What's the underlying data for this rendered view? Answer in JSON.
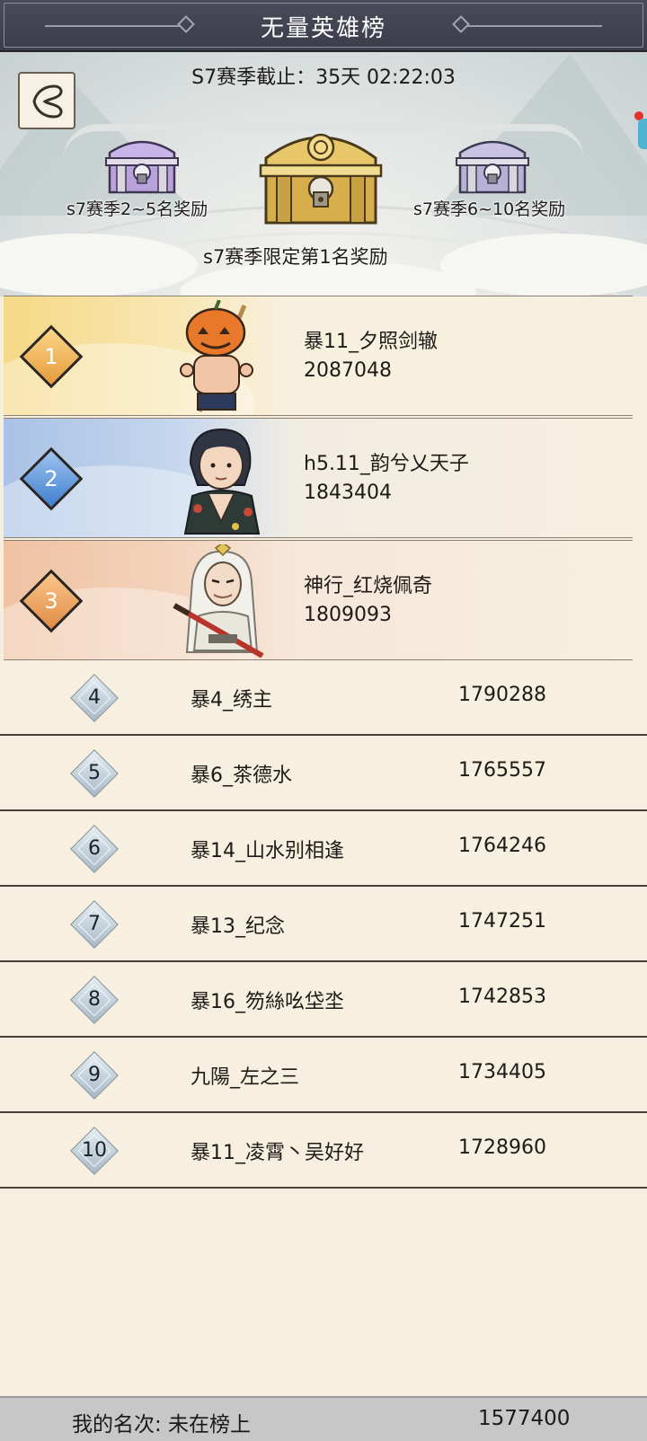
{
  "header": {
    "title": "无量英雄榜",
    "season_timer": "S7赛季截止：35天 02:22:03"
  },
  "rewards": {
    "left_label": "s7赛季2~5名奖励",
    "center_label": "s7赛季限定第1名奖励",
    "right_label": "s7赛季6~10名奖励"
  },
  "top3": [
    {
      "rank": "1",
      "name": "暴11_夕照剑辙",
      "score": "2087048"
    },
    {
      "rank": "2",
      "name": "h5.11_韵兮乂天子",
      "score": "1843404"
    },
    {
      "rank": "3",
      "name": "神行_红烧佩奇",
      "score": "1809093"
    }
  ],
  "list": [
    {
      "rank": "4",
      "name": "暴4_绣主",
      "score": "1790288"
    },
    {
      "rank": "5",
      "name": "暴6_茶德水",
      "score": "1765557"
    },
    {
      "rank": "6",
      "name": "暴14_山水别相逢",
      "score": "1764246"
    },
    {
      "rank": "7",
      "name": "暴13_纪念",
      "score": "1747251"
    },
    {
      "rank": "8",
      "name": "暴16_笏絲吆垈坔",
      "score": "1742853"
    },
    {
      "rank": "9",
      "name": "九陽_左之三",
      "score": "1734405"
    },
    {
      "rank": "10",
      "name": "暴11_凌霄丶吴好好",
      "score": "1728960"
    }
  ],
  "my_rank": {
    "label": "我的名次:  未在榜上",
    "score": "1577400"
  },
  "icons": {
    "back": "back-arrow-icon",
    "chest_center": "gold-chest-icon",
    "chest_side": "silver-chest-icon"
  },
  "colors": {
    "title_bar": "#3c3d4a",
    "rank1_bg": "#f6d987",
    "rank2_bg": "#a9c2e5",
    "rank3_bg": "#efc2a2",
    "list_bg": "#f7efe0",
    "my_rank_bar": "#c7c7c7"
  }
}
